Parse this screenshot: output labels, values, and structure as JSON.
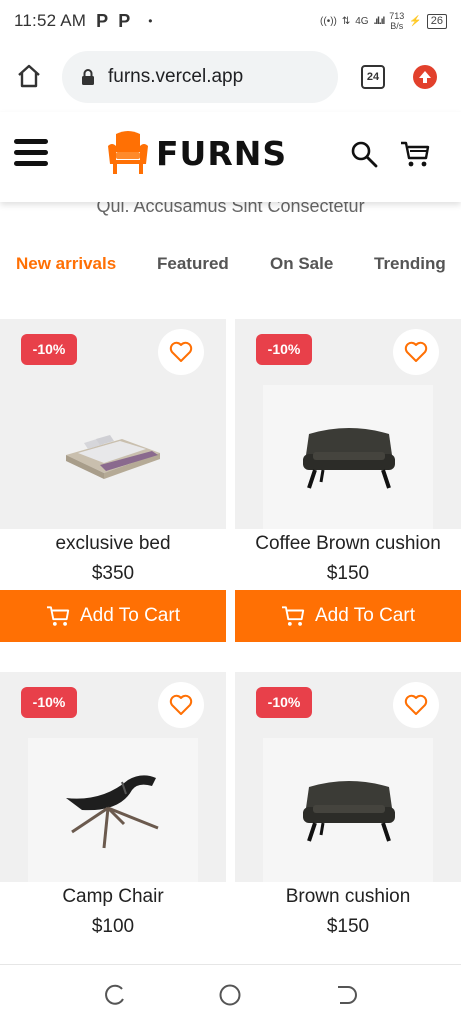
{
  "status_bar": {
    "time": "11:52 AM",
    "notif_1": "P",
    "notif_2": "P",
    "dot": "•",
    "net_type": "4G",
    "speed_value": "713",
    "speed_unit": "B/s",
    "battery": "26"
  },
  "browser": {
    "url": "furns.vercel.app",
    "tab_count": "24"
  },
  "header": {
    "brand": "FURNS"
  },
  "section": {
    "subtitle": "Qui. Accusamus Sint Consectetur",
    "tabs": [
      {
        "label": "New arrivals",
        "active": true
      },
      {
        "label": "Featured",
        "active": false
      },
      {
        "label": "On Sale",
        "active": false
      },
      {
        "label": "Trending",
        "active": false
      }
    ]
  },
  "products": [
    {
      "badge": "-10%",
      "name": "exclusive bed",
      "price": "$350",
      "button": "Add To Cart",
      "image": "bed"
    },
    {
      "badge": "-10%",
      "name": "Coffee Brown cushion",
      "price": "$150",
      "button": "Add To Cart",
      "image": "sofa"
    },
    {
      "badge": "-10%",
      "name": "Camp Chair",
      "price": "$100",
      "button": "",
      "image": "chair"
    },
    {
      "badge": "-10%",
      "name": "Brown cushion",
      "price": "$150",
      "button": "",
      "image": "sofa"
    }
  ],
  "colors": {
    "accent": "#ff7004",
    "badge": "#e8404a",
    "image_bg": "#f0f0f0"
  }
}
